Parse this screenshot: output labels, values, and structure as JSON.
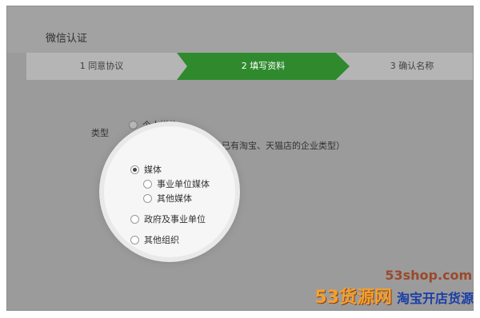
{
  "app": {
    "title": "微信认证"
  },
  "steps": [
    {
      "label": "1 同意协议",
      "active": false
    },
    {
      "label": "2 填写资料",
      "active": true
    },
    {
      "label": "3 确认名称",
      "active": false
    }
  ],
  "form": {
    "type_label": "类型",
    "options": [
      {
        "label": "个人媒体",
        "selected": false
      },
      {
        "label": "网店商家（淘宝店、已有淘宝、天猫店的企业类型）",
        "selected": false
      },
      {
        "label": "媒体",
        "selected": true,
        "sub": [
          "事业单位媒体",
          "其他媒体"
        ]
      },
      {
        "label": "政府及事业单位",
        "selected": false
      },
      {
        "label": "其他组织",
        "selected": false
      }
    ]
  },
  "watermark": {
    "site": "53shop.com",
    "brand": "53货源网",
    "slogan": "淘宝开店货源"
  },
  "colors": {
    "accent": "#2f8a2e",
    "overlay": "#9b9b9b",
    "lens": "#f6f6f6"
  }
}
